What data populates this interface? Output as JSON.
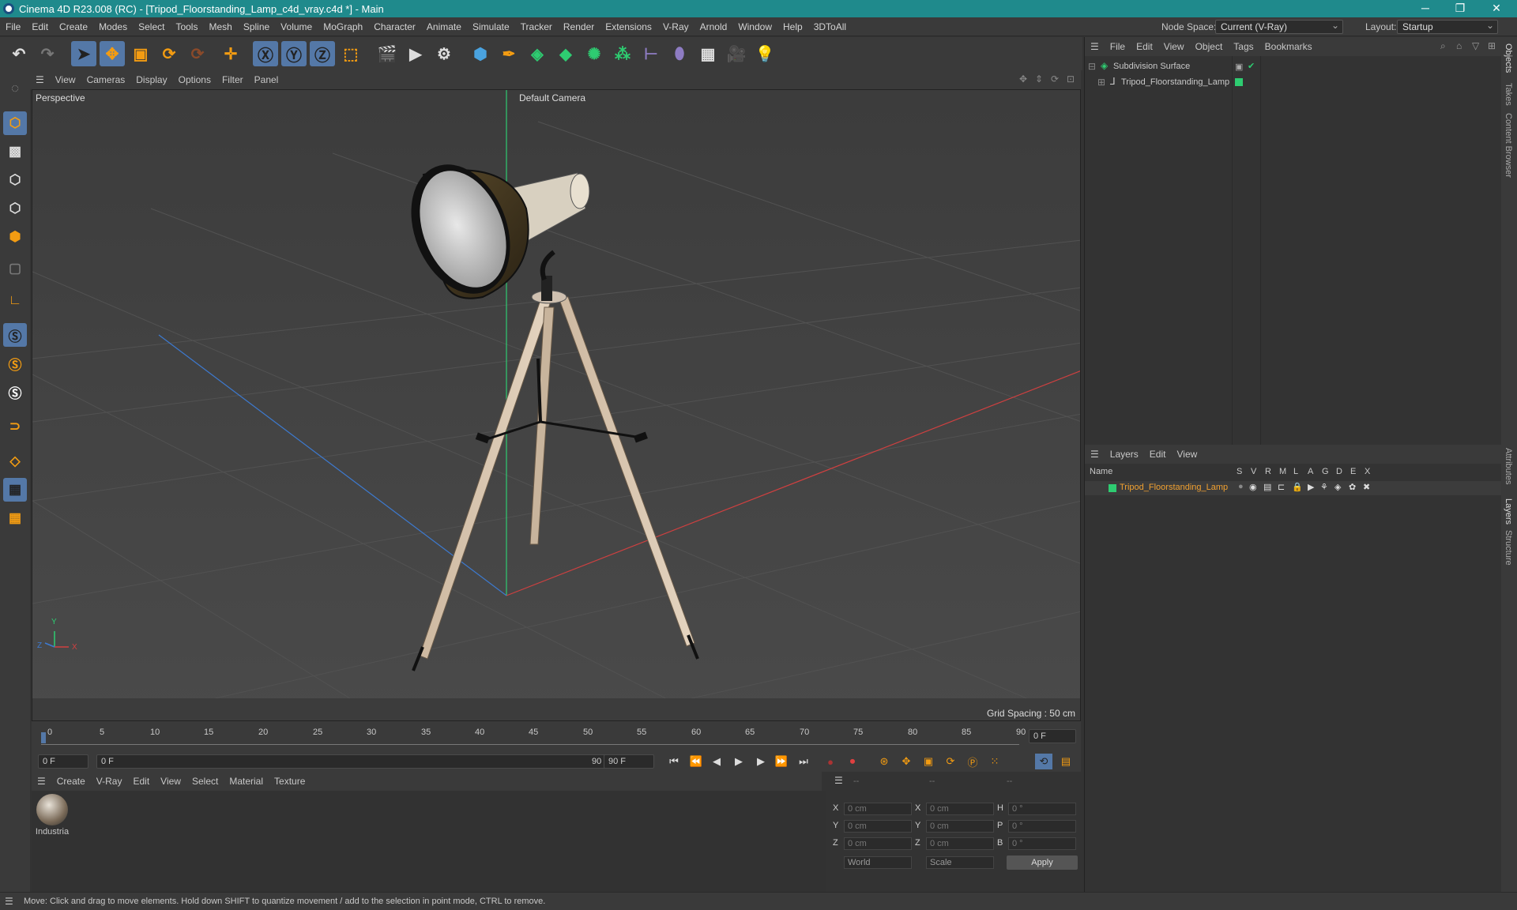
{
  "window": {
    "title": "Cinema 4D R23.008 (RC) - [Tripod_Floorstanding_Lamp_c4d_vray.c4d *] - Main",
    "minimize": "─",
    "restore": "❐",
    "close": "✕"
  },
  "menubar": {
    "items": [
      "File",
      "Edit",
      "Create",
      "Modes",
      "Select",
      "Tools",
      "Mesh",
      "Spline",
      "Volume",
      "MoGraph",
      "Character",
      "Animate",
      "Simulate",
      "Tracker",
      "Render",
      "Extensions",
      "V-Ray",
      "Arnold",
      "Window",
      "Help",
      "3DToAll"
    ],
    "node_space_label": "Node Space:",
    "node_space_value": "Current (V-Ray)",
    "layout_label": "Layout:",
    "layout_value": "Startup"
  },
  "viewport": {
    "menu": [
      "View",
      "Cameras",
      "Display",
      "Options",
      "Filter",
      "Panel"
    ],
    "label": "Perspective",
    "camera": "Default Camera",
    "grid_spacing": "Grid Spacing : 50 cm",
    "axis_x": "X",
    "axis_y": "Y",
    "axis_z": "Z"
  },
  "timeline": {
    "ticks": [
      "0",
      "5",
      "10",
      "15",
      "20",
      "25",
      "30",
      "35",
      "40",
      "45",
      "50",
      "55",
      "60",
      "65",
      "70",
      "75",
      "80",
      "85",
      "90"
    ],
    "current_frame": "0 F",
    "start_field": "0 F",
    "range_start": "0 F",
    "range_end": "90 F",
    "end_field": "90 F"
  },
  "material_panel": {
    "menu": [
      "Create",
      "V-Ray",
      "Edit",
      "View",
      "Select",
      "Material",
      "Texture"
    ],
    "materials": [
      {
        "name": "Industria"
      }
    ]
  },
  "coordinates": {
    "headers": [
      "--",
      "--",
      "--"
    ],
    "rows": [
      {
        "a": "X",
        "av": "0 cm",
        "b": "X",
        "bv": "0 cm",
        "c": "H",
        "cv": "0 °"
      },
      {
        "a": "Y",
        "av": "0 cm",
        "b": "Y",
        "bv": "0 cm",
        "c": "P",
        "cv": "0 °"
      },
      {
        "a": "Z",
        "av": "0 cm",
        "b": "Z",
        "bv": "0 cm",
        "c": "B",
        "cv": "0 °"
      }
    ],
    "space": "World",
    "mode": "Scale",
    "apply": "Apply"
  },
  "object_manager": {
    "menu": [
      "File",
      "Edit",
      "View",
      "Object",
      "Tags",
      "Bookmarks"
    ],
    "objects": [
      {
        "name": "Subdivision Surface"
      },
      {
        "name": "Tripod_Floorstanding_Lamp"
      }
    ]
  },
  "layer_manager": {
    "menu": [
      "Layers",
      "Edit",
      "View"
    ],
    "col_name": "Name",
    "flags": [
      "S",
      "V",
      "R",
      "M",
      "L",
      "A",
      "G",
      "D",
      "E",
      "X"
    ],
    "layers": [
      {
        "name": "Tripod_Floorstanding_Lamp",
        "color": "#2ecc71"
      }
    ]
  },
  "side_tabs": [
    "Objects",
    "Takes",
    "Content Browser",
    "Attributes",
    "Layers",
    "Structure"
  ],
  "status": "Move: Click and drag to move elements. Hold down SHIFT to quantize movement / add to the selection in point mode, CTRL to remove.",
  "colors": {
    "accent": "#5478a7",
    "title": "#1f8a8c",
    "layer": "#2ecc71",
    "layer_text": "#f0a030"
  }
}
